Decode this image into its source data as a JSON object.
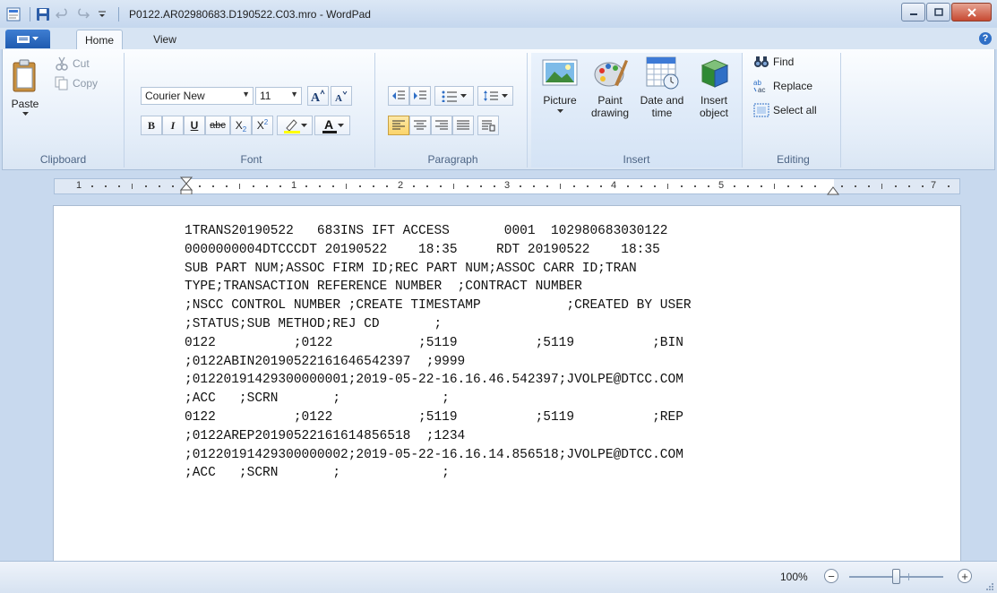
{
  "window": {
    "title": "P0122.AR02980683.D190522.C03.mro - WordPad"
  },
  "tabs": {
    "app_menu_icon": "menu-icon",
    "home": "Home",
    "view": "View"
  },
  "ribbon": {
    "clipboard": {
      "label": "Clipboard",
      "paste": "Paste",
      "cut": "Cut",
      "copy": "Copy"
    },
    "font": {
      "label": "Font",
      "family": "Courier New",
      "size": "11",
      "bold": "B",
      "italic": "I",
      "underline": "U",
      "strike": "abc",
      "subscript": "X",
      "superscript": "X"
    },
    "paragraph": {
      "label": "Paragraph"
    },
    "insert": {
      "label": "Insert",
      "picture": "Picture",
      "paint_line1": "Paint",
      "paint_line2": "drawing",
      "date_line1": "Date and",
      "date_line2": "time",
      "obj_line1": "Insert",
      "obj_line2": "object"
    },
    "editing": {
      "label": "Editing",
      "find": "Find",
      "replace": "Replace",
      "select_all": "Select all"
    }
  },
  "ruler": {
    "numbers": [
      "1",
      "1",
      "2",
      "3",
      "4",
      "5",
      "7"
    ]
  },
  "document": {
    "lines": [
      "1TRANS20190522   683INS IFT ACCESS       0001  102980683030122",
      "0000000004DTCCCDT 20190522    18:35     RDT 20190522    18:35",
      "SUB PART NUM;ASSOC FIRM ID;REC PART NUM;ASSOC CARR ID;TRAN",
      "TYPE;TRANSACTION REFERENCE NUMBER  ;CONTRACT NUMBER",
      ";NSCC CONTROL NUMBER ;CREATE TIMESTAMP           ;CREATED BY USER",
      ";STATUS;SUB METHOD;REJ CD       ;",
      "0122          ;0122           ;5119          ;5119          ;BIN",
      ";0122ABIN20190522161646542397  ;9999",
      ";01220191429300000001;2019-05-22-16.16.46.542397;JVOLPE@DTCC.COM",
      ";ACC   ;SCRN       ;             ;",
      "0122          ;0122           ;5119          ;5119          ;REP",
      ";0122AREP20190522161614856518  ;1234",
      ";01220191429300000002;2019-05-22-16.16.14.856518;JVOLPE@DTCC.COM",
      ";ACC   ;SCRN       ;             ;"
    ]
  },
  "status": {
    "zoom": "100%",
    "zoom_out": "−",
    "zoom_in": "+",
    "zoom_fraction": 0.5
  },
  "colors": {
    "accent": "#1f5bb0",
    "frame": "#c8d9ee"
  }
}
